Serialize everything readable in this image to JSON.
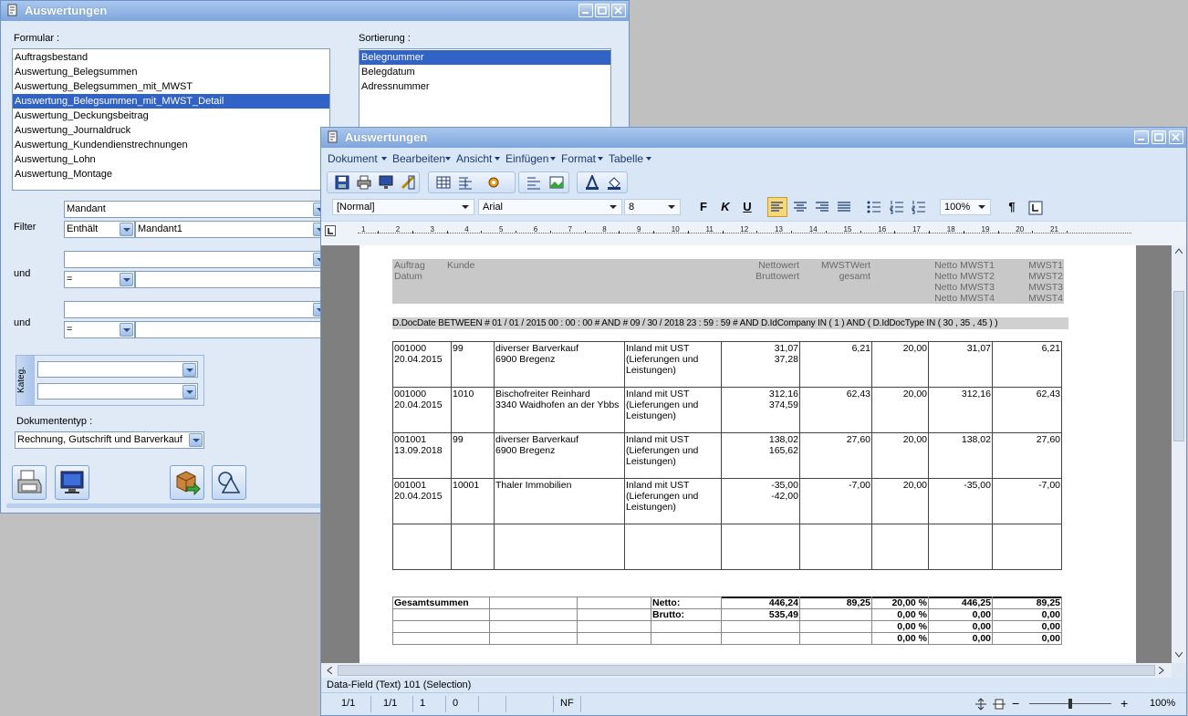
{
  "back_window": {
    "title": "Auswertungen",
    "formular_label": "Formular :",
    "sortierung_label": "Sortierung :",
    "formular_items": [
      {
        "label": "Auftragsbestand",
        "selected": false
      },
      {
        "label": "Auswertung_Belegsummen",
        "selected": false
      },
      {
        "label": "Auswertung_Belegsummen_mit_MWST",
        "selected": false
      },
      {
        "label": "Auswertung_Belegsummen_mit_MWST_Detail",
        "selected": true
      },
      {
        "label": "Auswertung_Deckungsbeitrag",
        "selected": false
      },
      {
        "label": "Auswertung_Journaldruck",
        "selected": false
      },
      {
        "label": "Auswertung_Kundendienstrechnungen",
        "selected": false
      },
      {
        "label": "Auswertung_Lohn",
        "selected": false
      },
      {
        "label": "Auswertung_Montage",
        "selected": false
      }
    ],
    "sortierung_items": [
      {
        "label": "Belegnummer",
        "selected": true
      },
      {
        "label": "Belegdatum",
        "selected": false
      },
      {
        "label": "Adressnummer",
        "selected": false
      }
    ],
    "filter_label": "Filter",
    "filter_field": "Mandant",
    "filter_op": "Enthält",
    "filter_value": "Mandant1",
    "und_label_1": "und",
    "und_label_2": "und",
    "und_op_1": "=",
    "und_op_2": "=",
    "kateg_label": "Kateg.",
    "dokumententyp_label": "Dokumententyp :",
    "dokumententyp_value": "Rechnung, Gutschrift und Barverkauf"
  },
  "front_window": {
    "title": "Auswertungen",
    "menu": [
      "Dokument",
      "Bearbeiten",
      "Ansicht",
      "Einfügen",
      "Format",
      "Tabelle"
    ],
    "style_combo": "[Normal]",
    "font_combo": "Arial",
    "size_combo": "8",
    "bold_label": "F",
    "italic_label": "K",
    "underline_label": "U",
    "zoom_combo": "100%",
    "pilcrow": "¶",
    "ruler_numbers": [
      "1",
      "2",
      "3",
      "4",
      "5",
      "6",
      "7",
      "8",
      "9",
      "10",
      "11",
      "12",
      "13",
      "14",
      "15",
      "16",
      "17",
      "18",
      "19",
      "20",
      "21"
    ],
    "report": {
      "header": {
        "auftrag": "Auftrag",
        "datum": "Datum",
        "kunde": "Kunde",
        "nettowert": "Nettowert",
        "bruttowert": "Bruttowert",
        "mwstwert": "MWSTWert",
        "gesamt": "gesamt",
        "netto_mwst": [
          "Netto MWST1",
          "Netto MWST2",
          "Netto MWST3",
          "Netto MWST4"
        ],
        "mwst": [
          "MWST1",
          "MWST2",
          "MWST3",
          "MWST4"
        ]
      },
      "filter_expression": "D.DocDate BETWEEN # 01 / 01 / 2015 00 : 00 : 00 # AND # 09 / 30 / 2018 23 : 59 : 59 # AND D.IdCompany IN ( 1 ) AND ( D.IdDocType IN ( 30 , 35 , 45 ) )",
      "rows": [
        {
          "nr": "001000",
          "date": "20.04.2015",
          "kunde": "99",
          "name1": "diverser Barverkauf",
          "name2": "6900 Bregenz",
          "steuer1": "Inland mit UST",
          "steuer2": "(Lieferungen und",
          "steuer3": "Leistungen)",
          "netto": "31,07",
          "brutto": "37,28",
          "mwst": "6,21",
          "satz": "20,00",
          "netto1": "31,07",
          "mwst1": "6,21"
        },
        {
          "nr": "001000",
          "date": "20.04.2015",
          "kunde": "1010",
          "name1": "Bischofreiter Reinhard",
          "name2": "3340 Waidhofen an der Ybbs",
          "steuer1": "Inland mit UST",
          "steuer2": "(Lieferungen und",
          "steuer3": "Leistungen)",
          "netto": "312,16",
          "brutto": "374,59",
          "mwst": "62,43",
          "satz": "20,00",
          "netto1": "312,16",
          "mwst1": "62,43"
        },
        {
          "nr": "001001",
          "date": "13.09.2018",
          "kunde": "99",
          "name1": "diverser Barverkauf",
          "name2": "6900 Bregenz",
          "steuer1": "Inland mit UST",
          "steuer2": "(Lieferungen und",
          "steuer3": "Leistungen)",
          "netto": "138,02",
          "brutto": "165,62",
          "mwst": "27,60",
          "satz": "20,00",
          "netto1": "138,02",
          "mwst1": "27,60"
        },
        {
          "nr": "001001",
          "date": "20.04.2015",
          "kunde": "10001",
          "name1": "Thaler Immobilien",
          "name2": "",
          "steuer1": "Inland mit UST",
          "steuer2": "(Lieferungen und",
          "steuer3": "Leistungen)",
          "netto": "-35,00",
          "brutto": "-42,00",
          "mwst": "-7,00",
          "satz": "20,00",
          "netto1": "-35,00",
          "mwst1": "-7,00"
        }
      ],
      "totals": {
        "label": "Gesamtsummen",
        "netto_label": "Netto:",
        "brutto_label": "Brutto:",
        "netto": "446,24",
        "brutto": "535,49",
        "mwst": "89,25",
        "satz_rows": [
          "20,00 %",
          "0,00 %",
          "0,00 %",
          "0,00 %"
        ],
        "netto_rows": [
          "446,25",
          "0,00",
          "0,00",
          "0,00"
        ],
        "mwst_rows": [
          "89,25",
          "0,00",
          "0,00",
          "0,00"
        ]
      }
    },
    "info_line": "Data-Field (Text) 101 (Selection)",
    "status": {
      "page": "1/1",
      "section": "1/1",
      "line": "1",
      "col": "0",
      "mode": "NF",
      "zoom": "100%"
    }
  }
}
